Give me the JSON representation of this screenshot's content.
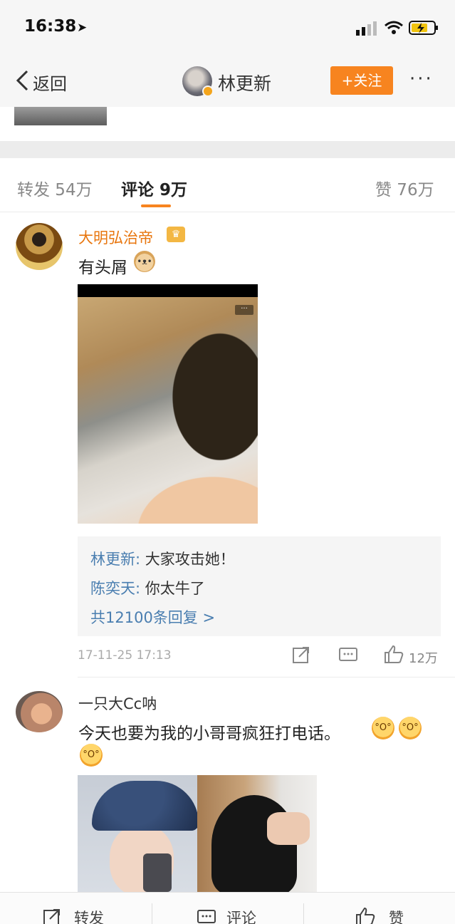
{
  "status_bar": {
    "time": "16:38",
    "location_icon": "location-arrow-icon"
  },
  "nav": {
    "back_label": "返回",
    "title": "林更新",
    "follow_label": "+关注",
    "more_label": "···"
  },
  "tabs": {
    "repost": "转发 54万",
    "comment": "评论 9万",
    "like": "赞 76万"
  },
  "comments": [
    {
      "username": "大明弘治帝",
      "text": "有头屑",
      "replies": [
        {
          "name": "林更新:",
          "text": " 大家攻击她！"
        },
        {
          "name": "陈奕天:",
          "text": " 你太牛了"
        }
      ],
      "reply_total": "共12100条回复 >",
      "timestamp": "17-11-25 17:13",
      "like_count": "12万"
    },
    {
      "username": "一只大Cc呐",
      "text": "今天也要为我的小哥哥疯狂打电话。"
    }
  ],
  "bottom_bar": {
    "repost": "转发",
    "comment": "评论",
    "like": "赞"
  },
  "colors": {
    "accent": "#f7841f",
    "link": "#4a7eb0",
    "vip_name": "#e8760e"
  }
}
